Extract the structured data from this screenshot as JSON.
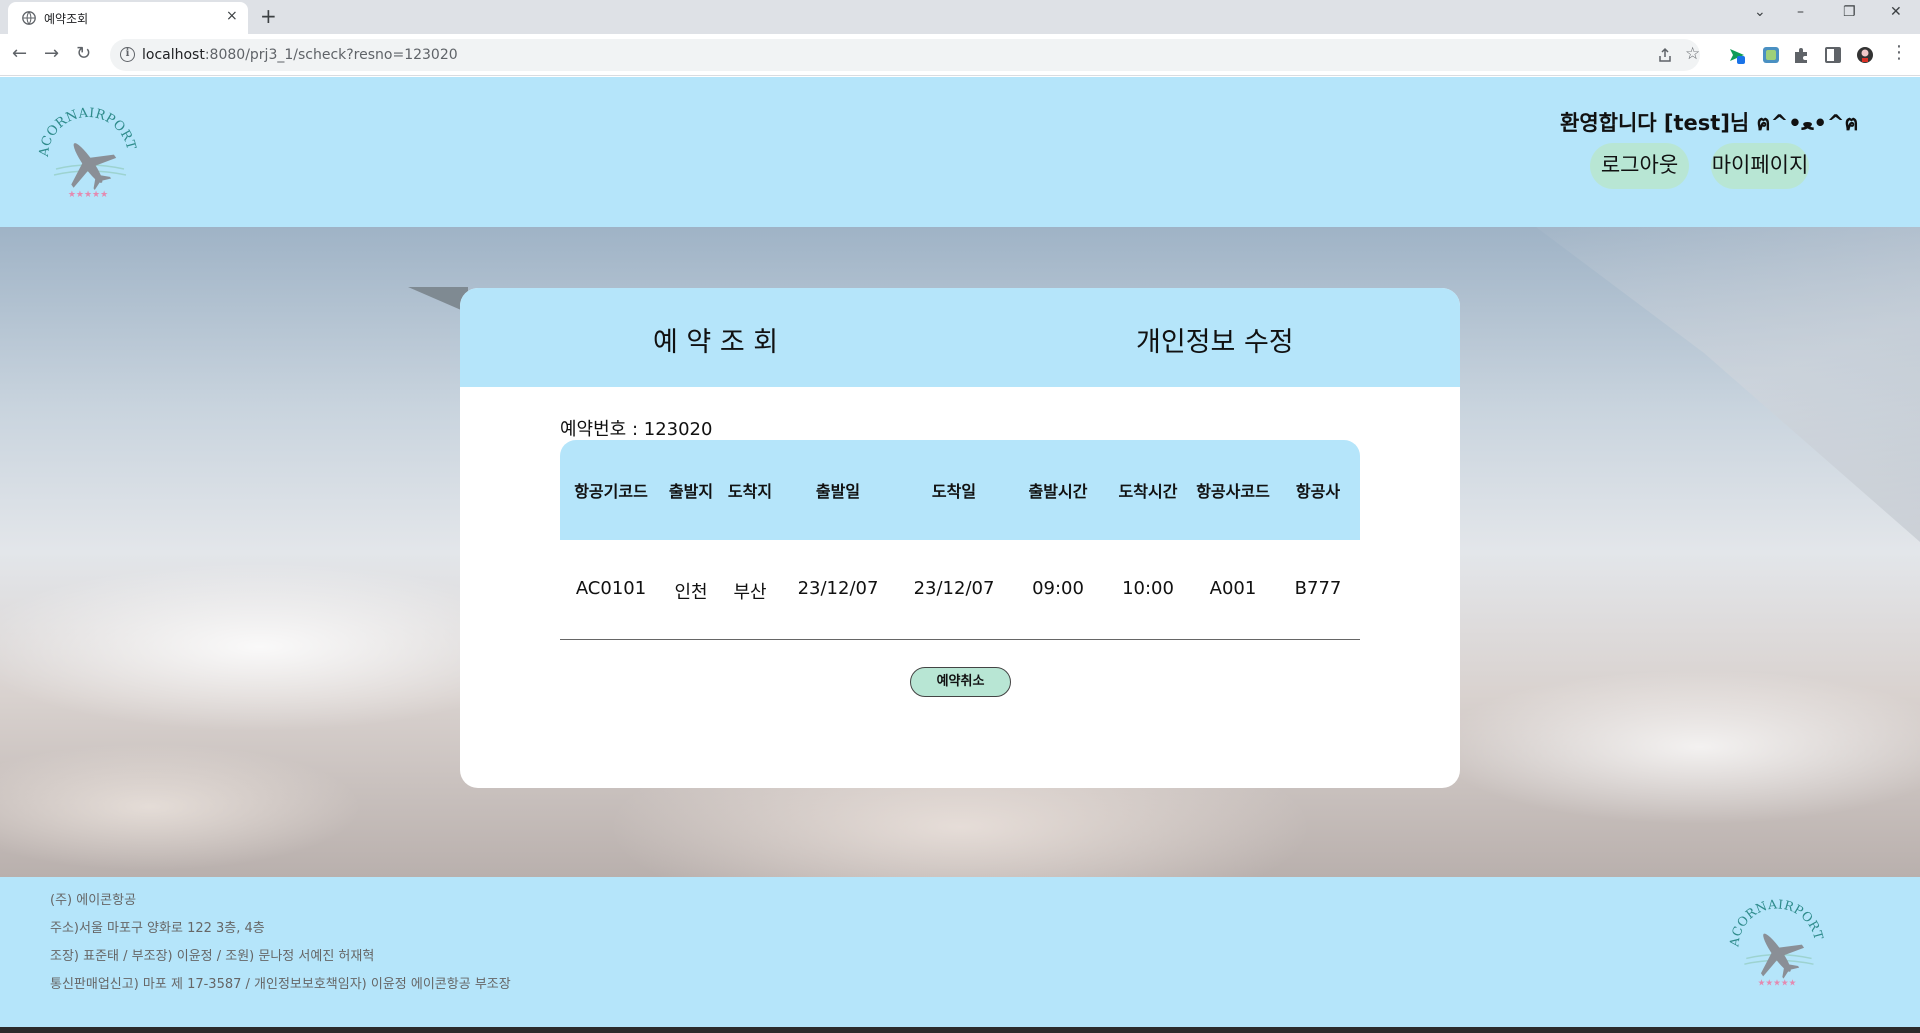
{
  "browser": {
    "tab_title": "예약조회",
    "new_tab_symbol": "+",
    "close_symbol": "×",
    "url_host": "localhost",
    "url_rest": ":8080/prj3_1/scheck?resno=123020",
    "window_controls": [
      "⌄",
      "–",
      "❐",
      "✕"
    ]
  },
  "header": {
    "logo_text": "ACORNAIRPORT",
    "welcome": "환영합니다 [test]님 ฅ^•ﻌ•^ฅ",
    "logout": "로그아웃",
    "mypage": "마이페이지"
  },
  "card": {
    "tab_reservation": "예 약 조 회",
    "tab_profile": "개인정보 수정",
    "reservation_number": "예약번호 : 123020",
    "columns": [
      "항공기코드",
      "출발지",
      "도착지",
      "출발일",
      "도착일",
      "출발시간",
      "도착시간",
      "항공사코드",
      "항공사"
    ],
    "row": [
      "AC0101",
      "인천",
      "부산",
      "23/12/07",
      "23/12/07",
      "09:00",
      "10:00",
      "A001",
      "B777"
    ],
    "cancel": "예약취소"
  },
  "footer": {
    "company": "(주) 에이콘항공",
    "address": "주소)서울 마포구 양화로 122 3층, 4층",
    "members": "조장) 표준태 / 부조장) 이윤정 / 조원) 문나정 서예진 허재혁",
    "registration": "통신판매업신고) 마포 제 17-3587 / 개인정보보호책임자) 이윤정 에이콘항공 부조장"
  },
  "colors": {
    "header_bg": "#b5e5fa",
    "button_bg": "#b8e6d4",
    "logo_text": "#2e8b8b",
    "plane": "#8a8f96"
  }
}
